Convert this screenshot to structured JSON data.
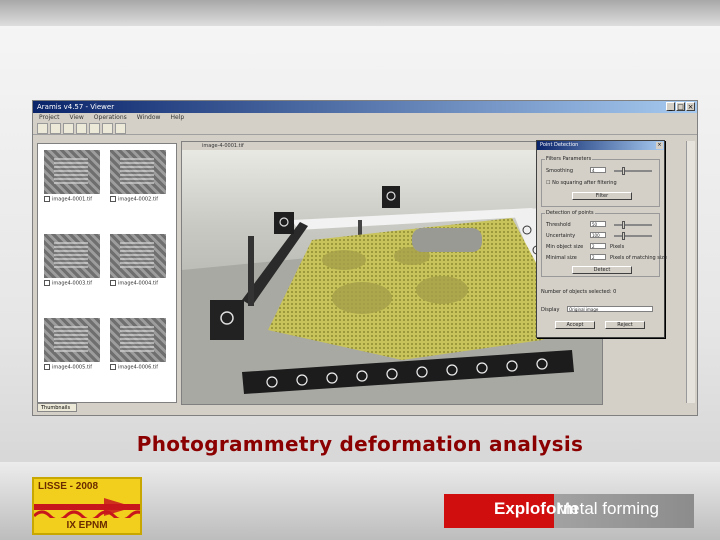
{
  "caption": "Photogrammetry deformation analysis",
  "app": {
    "title": "Aramis v4.57 - Viewer",
    "menu": [
      "Project",
      "View",
      "Operations",
      "Window",
      "Help"
    ],
    "image_window_title": "image-4-0001.tif",
    "panel_tab": "Thumbnails"
  },
  "thumbnails": [
    {
      "label": "image4-0001.tif"
    },
    {
      "label": "image4-0002.tif"
    },
    {
      "label": "image4-0003.tif"
    },
    {
      "label": "image4-0004.tif"
    },
    {
      "label": "image4-0005.tif"
    },
    {
      "label": "image4-0006.tif"
    }
  ],
  "dialog": {
    "title": "Point Detection",
    "filter_group": "Filters Parameters",
    "smoothing_label": "Smoothing",
    "smoothing_value": "4",
    "no_squaring_label": "No squaring after filtering",
    "filter_button": "Filter",
    "detection_group": "Detection of points",
    "threshold_label": "Threshold",
    "threshold_value": "50",
    "uncertainty_label": "Uncertainty",
    "uncertainty_value": "100",
    "min_object_size_label": "Min object size",
    "min_object_size_value": "2",
    "pixels_label": "Pixels",
    "minimal_size_label": "Minimal size",
    "minimal_size_value": "2",
    "matching_size_label": "Pixels of matching size",
    "detect_button": "Detect",
    "objects_selected": "Number of objects selected: 0",
    "display_label": "Display",
    "display_value": "Original image",
    "accept_button": "Accept",
    "reject_button": "Reject"
  },
  "logos": {
    "lisse_top": "LISSE - 2008",
    "lisse_bottom": "IX  EPNM",
    "exploform_bold": "Exploform",
    "exploform_regular": "Metal forming"
  },
  "colors": {
    "caption": "#8b0000",
    "exploform_red": "#d10e0e",
    "lisse_yellow": "#f2cf1c",
    "lisse_red": "#c8161d"
  }
}
